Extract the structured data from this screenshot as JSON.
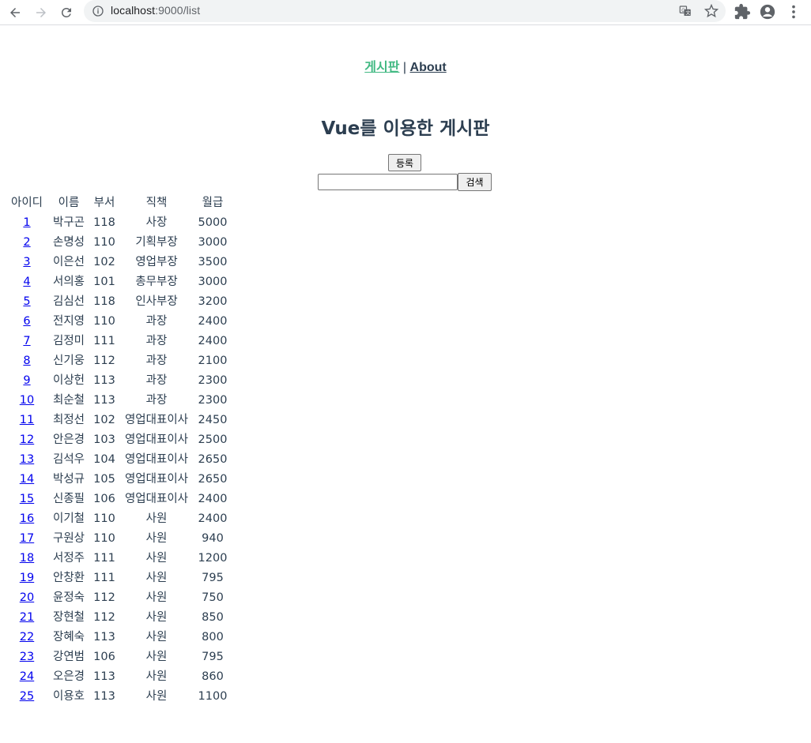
{
  "browser": {
    "url_host": "localhost",
    "url_port_path": ":9000/list"
  },
  "nav": {
    "board_link": "게시판",
    "separator": "|",
    "about_link": "About"
  },
  "page_title": "Vue를 이용한 게시판",
  "register_button": "등록",
  "search": {
    "value": "",
    "button": "검색"
  },
  "table": {
    "headers": [
      "아이디",
      "이름",
      "부서",
      "직책",
      "월급"
    ],
    "rows": [
      [
        "1",
        "박구곤",
        "118",
        "사장",
        "5000"
      ],
      [
        "2",
        "손명성",
        "110",
        "기획부장",
        "3000"
      ],
      [
        "3",
        "이은선",
        "102",
        "영업부장",
        "3500"
      ],
      [
        "4",
        "서의홍",
        "101",
        "총무부장",
        "3000"
      ],
      [
        "5",
        "김심선",
        "118",
        "인사부장",
        "3200"
      ],
      [
        "6",
        "전지영",
        "110",
        "과장",
        "2400"
      ],
      [
        "7",
        "김정미",
        "111",
        "과장",
        "2400"
      ],
      [
        "8",
        "신기웅",
        "112",
        "과장",
        "2100"
      ],
      [
        "9",
        "이상헌",
        "113",
        "과장",
        "2300"
      ],
      [
        "10",
        "최순철",
        "113",
        "과장",
        "2300"
      ],
      [
        "11",
        "최정선",
        "102",
        "영업대표이사",
        "2450"
      ],
      [
        "12",
        "안은경",
        "103",
        "영업대표이사",
        "2500"
      ],
      [
        "13",
        "김석우",
        "104",
        "영업대표이사",
        "2650"
      ],
      [
        "14",
        "박성규",
        "105",
        "영업대표이사",
        "2650"
      ],
      [
        "15",
        "신종필",
        "106",
        "영업대표이사",
        "2400"
      ],
      [
        "16",
        "이기철",
        "110",
        "사원",
        "2400"
      ],
      [
        "17",
        "구원상",
        "110",
        "사원",
        "940"
      ],
      [
        "18",
        "서정주",
        "111",
        "사원",
        "1200"
      ],
      [
        "19",
        "안창환",
        "111",
        "사원",
        "795"
      ],
      [
        "20",
        "윤정숙",
        "112",
        "사원",
        "750"
      ],
      [
        "21",
        "장현철",
        "112",
        "사원",
        "850"
      ],
      [
        "22",
        "장혜숙",
        "113",
        "사원",
        "800"
      ],
      [
        "23",
        "강연범",
        "106",
        "사원",
        "795"
      ],
      [
        "24",
        "오은경",
        "113",
        "사원",
        "860"
      ],
      [
        "25",
        "이용호",
        "113",
        "사원",
        "1100"
      ]
    ]
  },
  "colors": {
    "text": "#2c3e50",
    "active_link": "#42b983",
    "link": "#0000ee"
  }
}
